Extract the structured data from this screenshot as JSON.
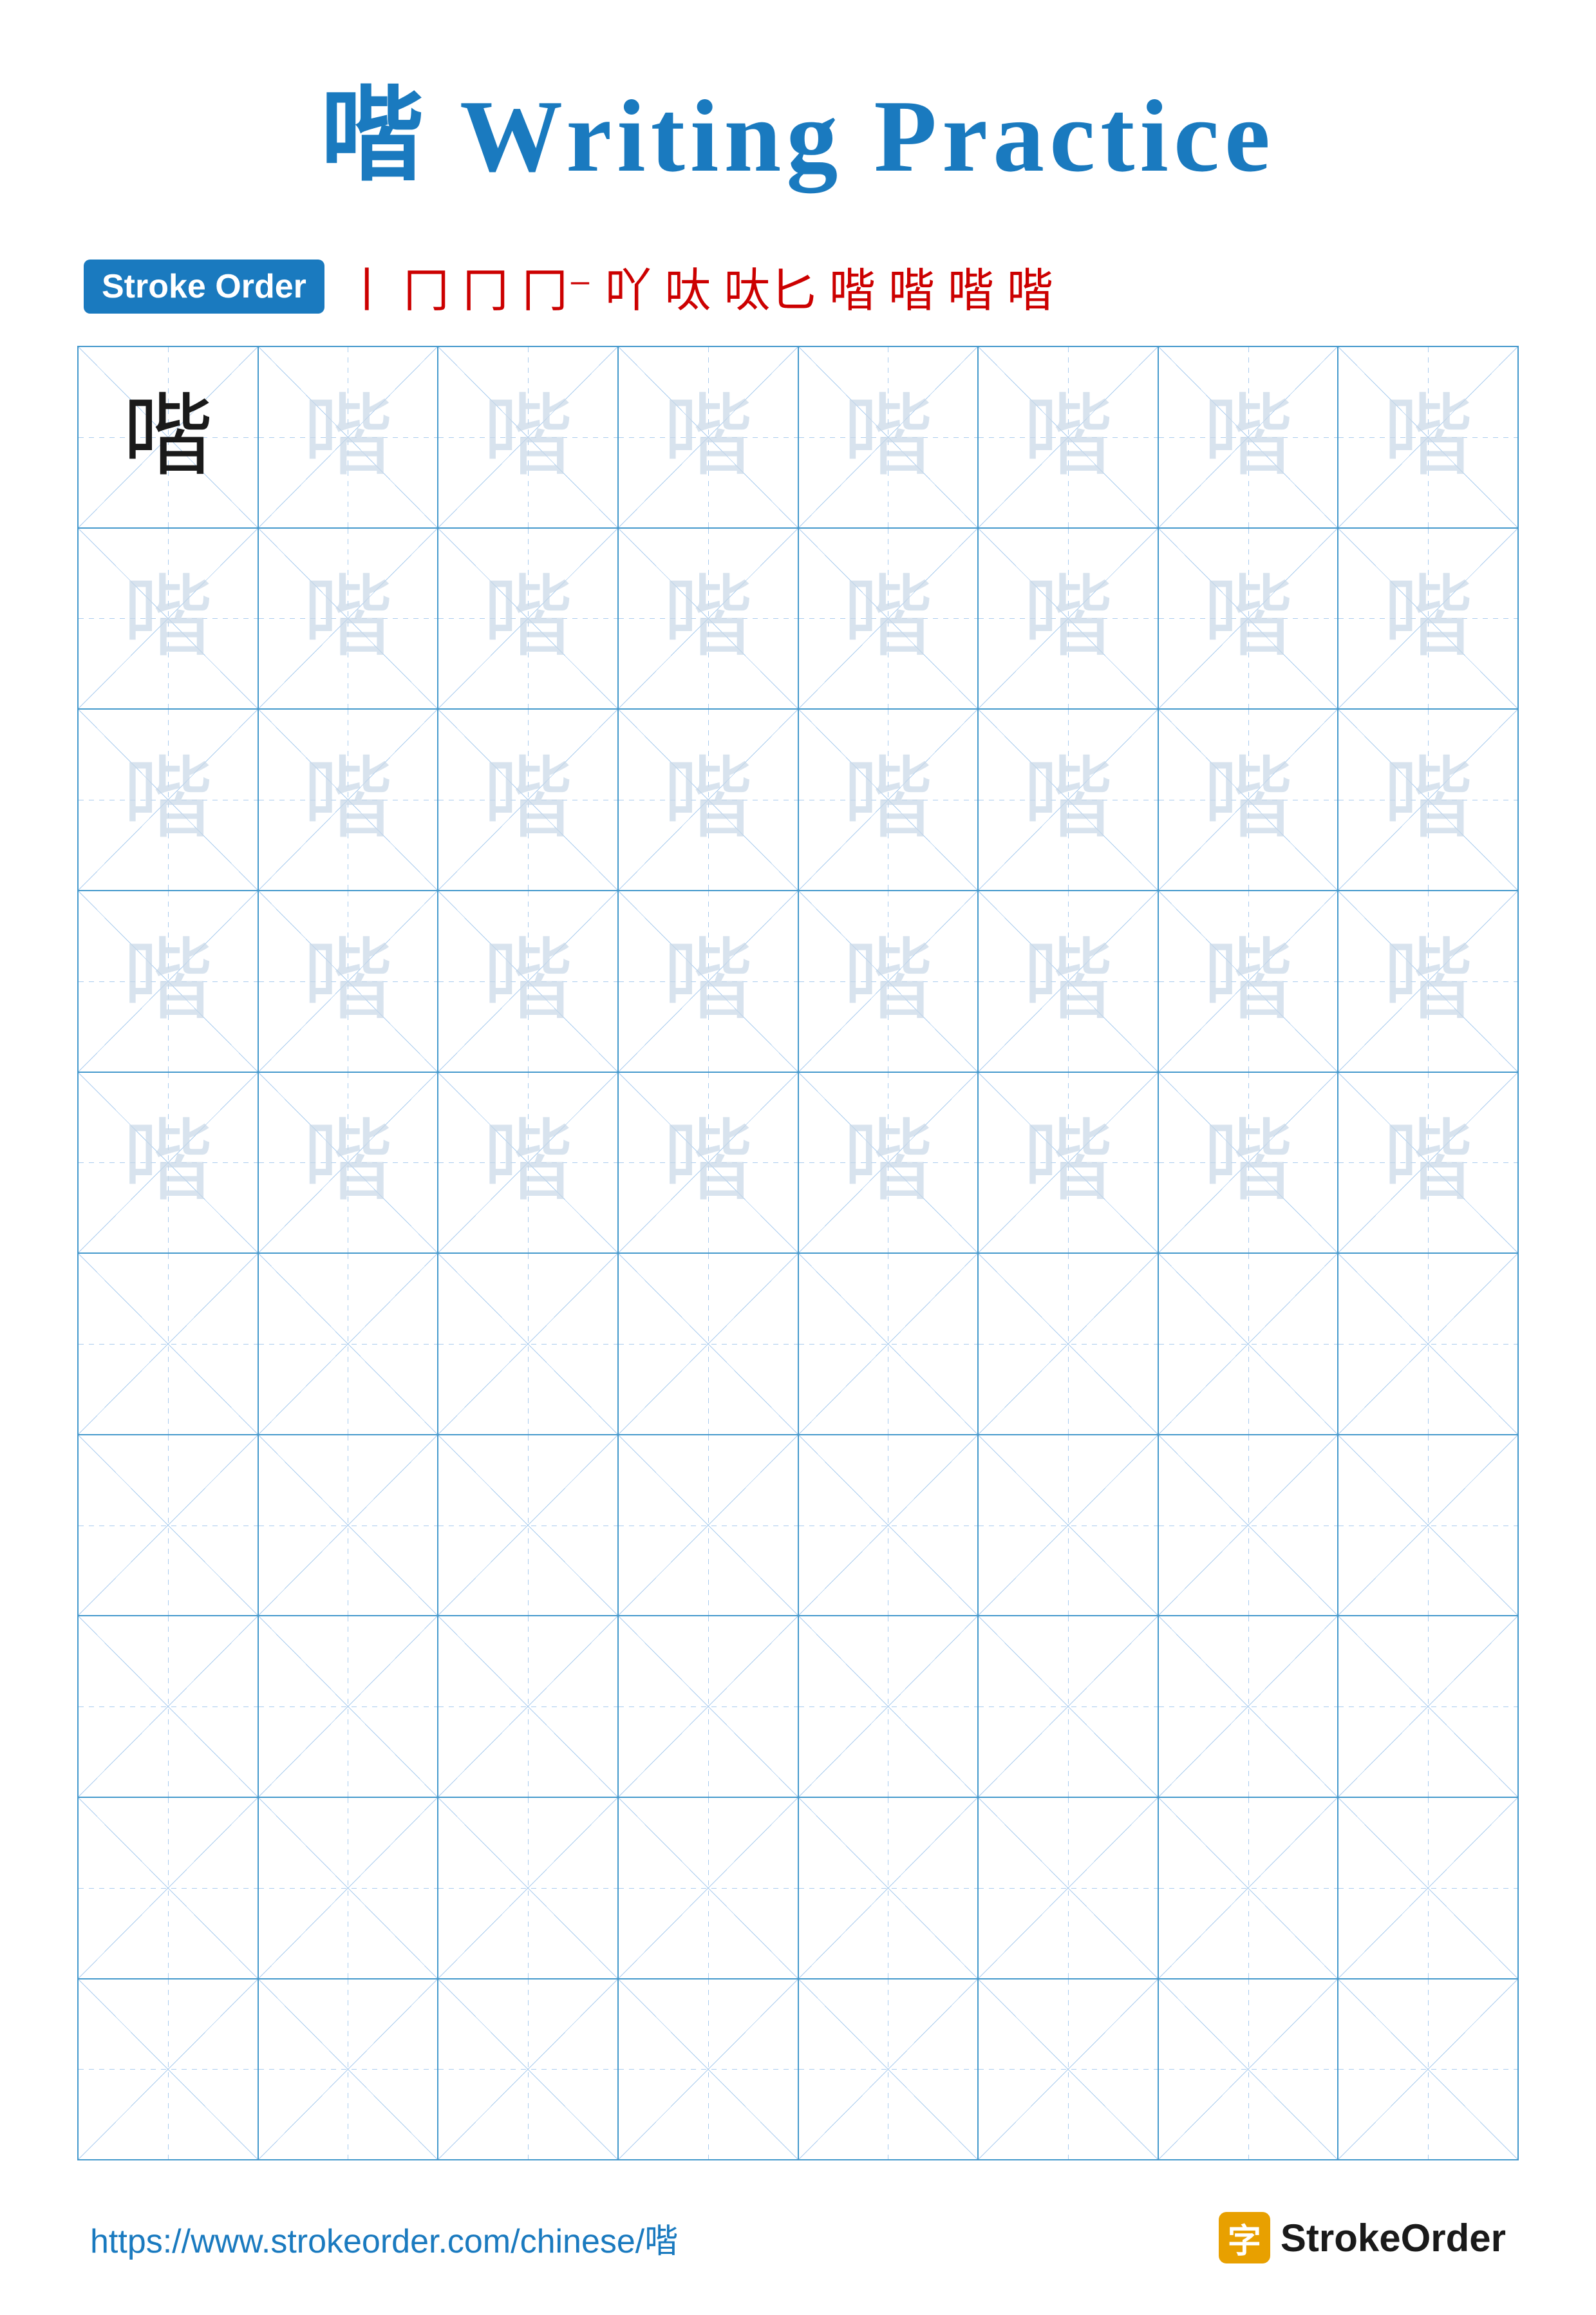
{
  "page": {
    "title": "喈 Writing Practice",
    "character": "喈",
    "stroke_order": {
      "badge_label": "Stroke Order",
      "steps": [
        "丨",
        "冂",
        "冂",
        "冂⁻",
        "冂卜",
        "冂卜⁻",
        "冂卜匕",
        "冂卜匕匕",
        "喈",
        "喈喈",
        "喈"
      ]
    },
    "grid": {
      "rows": 10,
      "cols": 8,
      "practice_rows": 5,
      "empty_rows": 5
    },
    "footer": {
      "url": "https://www.strokeorder.com/chinese/喈",
      "brand": "StrokeOrder",
      "brand_char": "字"
    }
  }
}
